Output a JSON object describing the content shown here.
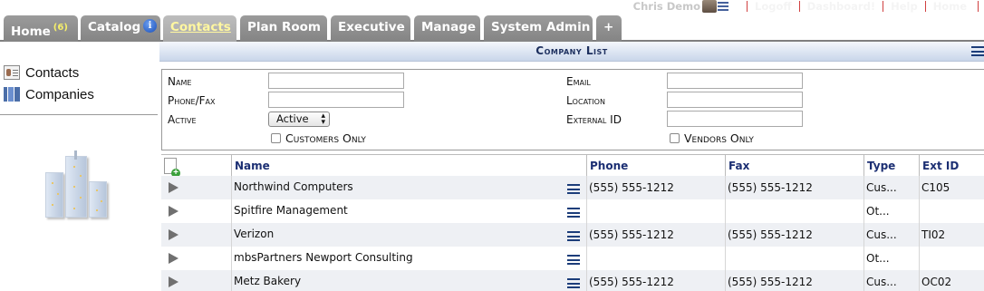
{
  "toplinks": {
    "user": "Chris Demo",
    "items": [
      "Logoff",
      "Dashboard!",
      "Help",
      "Home"
    ]
  },
  "tabs": [
    {
      "label": "Home",
      "count": "(6)"
    },
    {
      "label": "Catalog",
      "info": "i"
    },
    {
      "label": "Contacts"
    },
    {
      "label": "Plan Room"
    },
    {
      "label": "Executive"
    },
    {
      "label": "Manage"
    },
    {
      "label": "System Admin"
    },
    {
      "label": "+"
    }
  ],
  "sidebar": {
    "items": [
      {
        "label": "Contacts",
        "icon": "contact-card-icon"
      },
      {
        "label": "Companies",
        "icon": "buildings-icon"
      }
    ]
  },
  "list": {
    "title": "Company List"
  },
  "filters": {
    "name_label": "Name",
    "phone_label": "Phone/Fax",
    "active_label": "Active",
    "active_value": "Active",
    "customers_only": "Customers Only",
    "email_label": "Email",
    "location_label": "Location",
    "external_id_label": "External ID",
    "vendors_only": "Vendors Only"
  },
  "table": {
    "columns": [
      "Name",
      "Phone",
      "Fax",
      "Type",
      "Ext ID"
    ],
    "rows": [
      {
        "name": "Northwind Computers",
        "phone": "(555) 555-1212",
        "fax": "(555) 555-1212",
        "type": "Cus...",
        "ext": "C105"
      },
      {
        "name": "Spitfire Management",
        "phone": "",
        "fax": "",
        "type": "Ot...",
        "ext": ""
      },
      {
        "name": "Verizon",
        "phone": "(555) 555-1212",
        "fax": "(555) 555-1212",
        "type": "Cus...",
        "ext": "TI02"
      },
      {
        "name": "mbsPartners Newport Consulting",
        "phone": "",
        "fax": "",
        "type": "Ot...",
        "ext": ""
      },
      {
        "name": "Metz Bakery",
        "phone": "(555) 555-1212",
        "fax": "(555) 555-1212",
        "type": "Cus...",
        "ext": "OC02"
      }
    ]
  },
  "colors": {
    "tab_bg": "#8c8c8c",
    "tab_active_text": "#fff7a0",
    "header_text": "#1c2f73",
    "row_alt": "#eef0f4"
  }
}
